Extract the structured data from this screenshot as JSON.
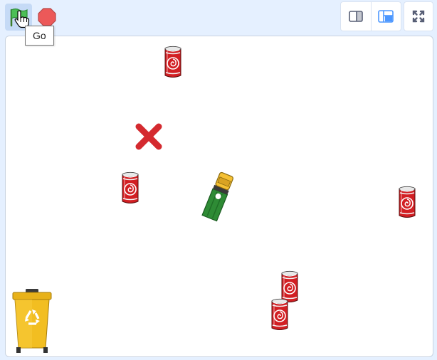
{
  "toolbar": {
    "green_flag_icon": "green-flag-icon",
    "stop_icon": "stop-sign-icon",
    "tooltip": "Go",
    "small_stage_icon": "small-stage-icon",
    "large_stage_icon": "large-stage-icon",
    "fullscreen_icon": "fullscreen-icon"
  },
  "stage": {
    "sprites": [
      "soda-can",
      "soda-can",
      "soda-can",
      "soda-can",
      "soda-can",
      "x-mark",
      "truck",
      "recycle-bin"
    ]
  },
  "colors": {
    "toolbar_bg": "#e5f0ff",
    "accent": "#4c97ff",
    "stop": "#ec5959",
    "can": "#d21f23",
    "x_mark": "#d42a2f",
    "truck_body": "#2e8b35",
    "truck_cab": "#f5c033",
    "bin": "#f2be21"
  }
}
